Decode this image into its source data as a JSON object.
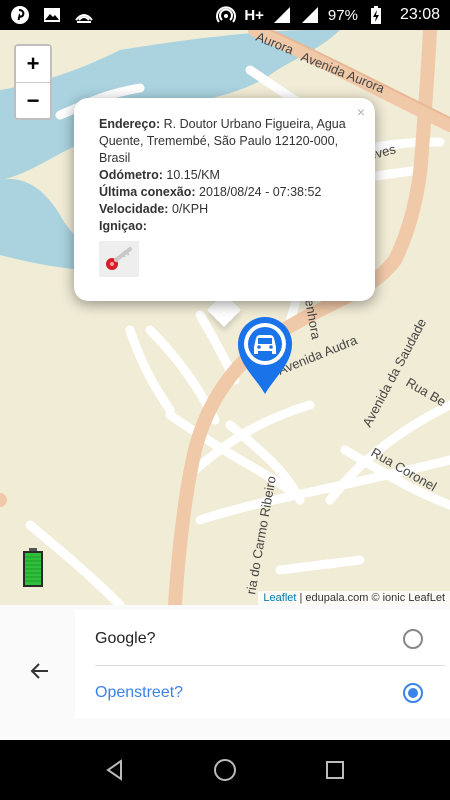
{
  "status_bar": {
    "network_type": "H+",
    "battery_percent": "97%",
    "time": "23:08",
    "left_icons": [
      "pinterest-icon",
      "gallery-icon",
      "cast-icon"
    ],
    "right_icons": [
      "hotspot-icon",
      "signal-icon",
      "signal-icon",
      "battery-charging-icon"
    ]
  },
  "map": {
    "street_labels": [
      "Avenida Aurora",
      "Aurora",
      "Avenida Audra",
      "Avenida da Saudade",
      "Rua Be",
      "Rua Coronel",
      "ria do Carmo Ribeiro",
      "eves",
      "enhora"
    ],
    "zoom_in": "+",
    "zoom_out": "−",
    "attribution_link": "Leaflet",
    "attribution_text": "| edupala.com © ionic LeafLet"
  },
  "popup": {
    "close": "×",
    "address_label": "Endereço:",
    "address_value": "R. Doutor Urbano Figueira, Agua Quente, Tremembé, São Paulo 12120-000, Brasil",
    "odometer_label": "Odómetro:",
    "odometer_value": "10.15/KM",
    "last_connection_label": "Última conexão:",
    "last_connection_value": "2018/08/24 - 07:38:52",
    "speed_label": "Velocidade:",
    "speed_value": "0/KPH",
    "ignition_label": "Igniçao:",
    "ignition_icon": "key-icon"
  },
  "sheet": {
    "options": [
      {
        "label": "Google?",
        "selected": false
      },
      {
        "label": "Openstreet?",
        "selected": true
      }
    ]
  },
  "colors": {
    "accent": "#3a83e8",
    "marker": "#1a73e8",
    "map_land": "#f1ecd6",
    "water": "#aad3df",
    "major_road": "#f0c9a8",
    "battery": "#2fbf3a"
  }
}
